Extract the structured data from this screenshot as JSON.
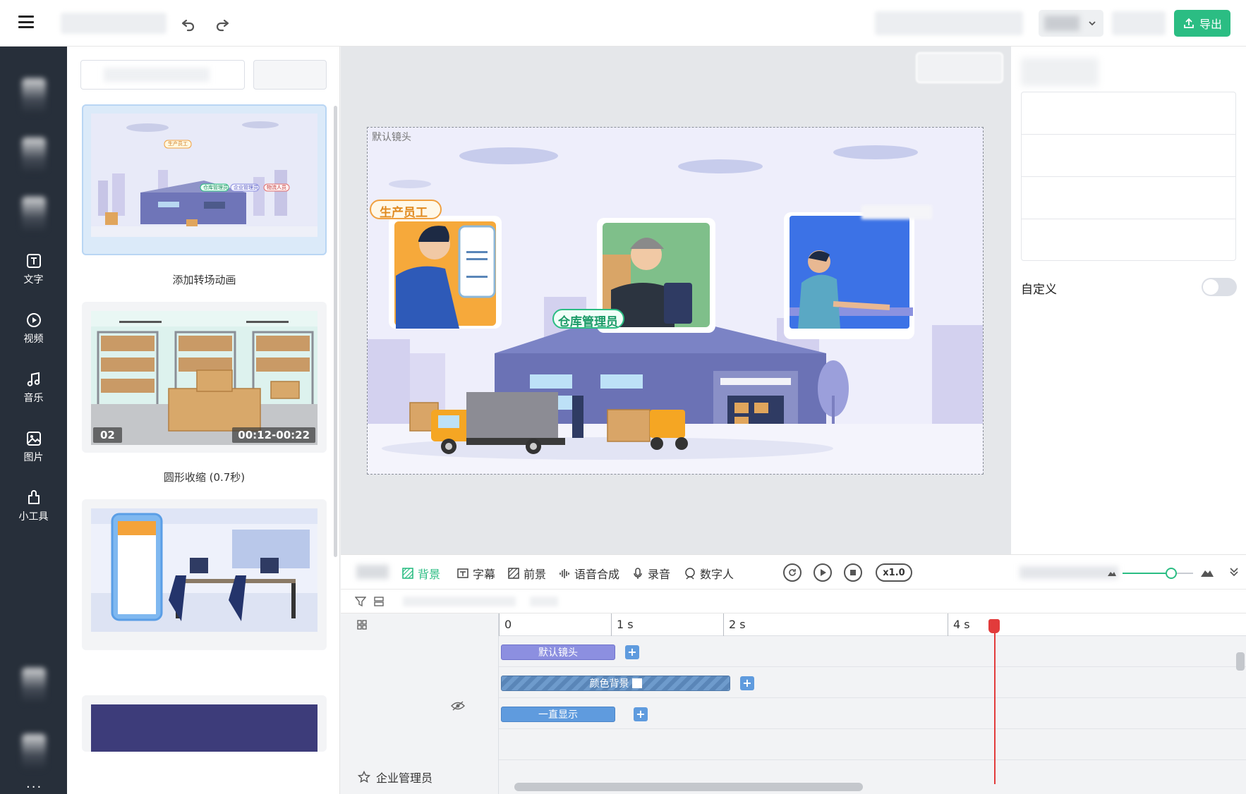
{
  "toolbar": {
    "export_label": "导出",
    "colors": {
      "accent": "#2bbd83",
      "sidebar_bg": "#272f3a"
    }
  },
  "sidebar": {
    "items": [
      {
        "label": "文字",
        "icon": "text-icon"
      },
      {
        "label": "视频",
        "icon": "video-icon"
      },
      {
        "label": "音乐",
        "icon": "music-icon"
      },
      {
        "label": "图片",
        "icon": "image-icon"
      },
      {
        "label": "小工具",
        "icon": "tools-icon"
      }
    ],
    "more_label": "···"
  },
  "panel": {
    "cards": [
      {
        "label": "添加转场动画",
        "selected": true,
        "scene_tags": [
          "生产员工",
          "仓库管理员",
          "企业管理员",
          "物流人员"
        ]
      },
      {
        "label": "圆形收缩 (0.7秒)",
        "number": "02",
        "time": "00:12-00:22"
      },
      {
        "label": ""
      },
      {
        "label": ""
      }
    ]
  },
  "canvas": {
    "scene_label": "默认镜头",
    "tags": {
      "worker": "生产员工",
      "manager": "仓库管理员"
    }
  },
  "props": {
    "custom_label": "自定义",
    "custom_enabled": false
  },
  "timeline": {
    "tabs": [
      {
        "label": "背景",
        "icon": "background-icon",
        "active": true
      },
      {
        "label": "字幕",
        "icon": "subtitle-icon"
      },
      {
        "label": "前景",
        "icon": "foreground-icon"
      },
      {
        "label": "语音合成",
        "icon": "voice-synthesis-icon"
      },
      {
        "label": "录音",
        "icon": "microphone-icon"
      },
      {
        "label": "数字人",
        "icon": "digital-human-icon"
      }
    ],
    "speed_label": "x1.0",
    "ruler": [
      "0",
      "1 s",
      "2 s",
      "4 s"
    ],
    "clips": {
      "camera": "默认镜头",
      "background": "颜色背景",
      "always_show": "一直显示"
    },
    "row_label": "企业管理员",
    "add_label": "+"
  }
}
